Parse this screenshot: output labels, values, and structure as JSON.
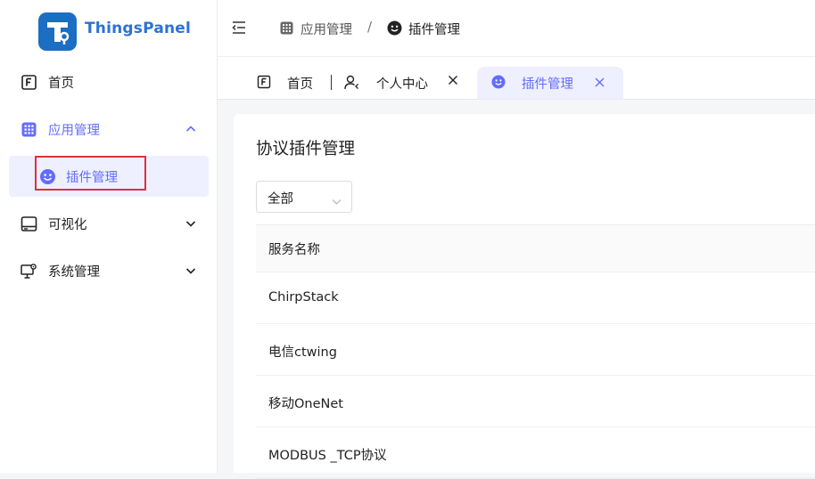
{
  "brand": {
    "name": "ThingsPanel"
  },
  "sidebar": {
    "items": [
      {
        "label": "首页",
        "icon": "home-icon"
      },
      {
        "label": "应用管理",
        "icon": "grid-icon",
        "expanded": true,
        "children": [
          {
            "label": "插件管理",
            "icon": "smiley-icon",
            "active": true
          }
        ]
      },
      {
        "label": "可视化",
        "icon": "monitor-icon",
        "expanded": false
      },
      {
        "label": "系统管理",
        "icon": "monitor-gear-icon",
        "expanded": false
      }
    ]
  },
  "breadcrumb": {
    "parent": "应用管理",
    "separator": "/",
    "current": "插件管理"
  },
  "tabs": [
    {
      "label": "首页",
      "icon": "home-icon",
      "closable": false
    },
    {
      "label": "个人中心",
      "icon": "user-icon",
      "closable": true
    },
    {
      "label": "插件管理",
      "icon": "smiley-icon",
      "closable": true,
      "active": true
    }
  ],
  "main": {
    "title": "协议插件管理",
    "filter": {
      "value": "全部"
    },
    "table": {
      "columns": [
        "服务名称"
      ],
      "rows": [
        "ChirpStack",
        "电信ctwing",
        "移动OneNet",
        "MODBUS _TCP协议"
      ]
    }
  },
  "colors": {
    "accent": "#646cff",
    "brand": "#1b6ec2",
    "highlight_box": "#e0303a"
  }
}
